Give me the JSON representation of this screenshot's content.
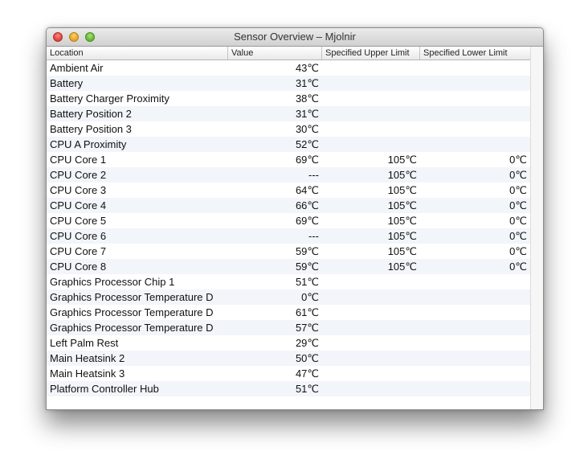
{
  "window": {
    "title": "Sensor Overview – Mjolnir"
  },
  "table": {
    "columns": [
      "Location",
      "Value",
      "Specified Upper Limit",
      "Specified Lower Limit"
    ],
    "rows": [
      {
        "location": "Ambient Air",
        "value": "43℃",
        "upper": "",
        "lower": ""
      },
      {
        "location": "Battery",
        "value": "31℃",
        "upper": "",
        "lower": ""
      },
      {
        "location": "Battery Charger Proximity",
        "value": "38℃",
        "upper": "",
        "lower": ""
      },
      {
        "location": "Battery Position 2",
        "value": "31℃",
        "upper": "",
        "lower": ""
      },
      {
        "location": "Battery Position 3",
        "value": "30℃",
        "upper": "",
        "lower": ""
      },
      {
        "location": "CPU A Proximity",
        "value": "52℃",
        "upper": "",
        "lower": ""
      },
      {
        "location": "CPU Core 1",
        "value": "69℃",
        "upper": "105℃",
        "lower": "0℃"
      },
      {
        "location": "CPU Core 2",
        "value": "---",
        "upper": "105℃",
        "lower": "0℃"
      },
      {
        "location": "CPU Core 3",
        "value": "64℃",
        "upper": "105℃",
        "lower": "0℃"
      },
      {
        "location": "CPU Core 4",
        "value": "66℃",
        "upper": "105℃",
        "lower": "0℃"
      },
      {
        "location": "CPU Core 5",
        "value": "69℃",
        "upper": "105℃",
        "lower": "0℃"
      },
      {
        "location": "CPU Core 6",
        "value": "---",
        "upper": "105℃",
        "lower": "0℃"
      },
      {
        "location": "CPU Core 7",
        "value": "59℃",
        "upper": "105℃",
        "lower": "0℃"
      },
      {
        "location": "CPU Core 8",
        "value": "59℃",
        "upper": "105℃",
        "lower": "0℃"
      },
      {
        "location": "Graphics Processor Chip 1",
        "value": "51℃",
        "upper": "",
        "lower": ""
      },
      {
        "location": "Graphics Processor Temperature D",
        "value": "0℃",
        "upper": "",
        "lower": ""
      },
      {
        "location": "Graphics Processor Temperature D",
        "value": "61℃",
        "upper": "",
        "lower": ""
      },
      {
        "location": "Graphics Processor Temperature D",
        "value": "57℃",
        "upper": "",
        "lower": ""
      },
      {
        "location": "Left Palm Rest",
        "value": "29℃",
        "upper": "",
        "lower": ""
      },
      {
        "location": "Main Heatsink 2",
        "value": "50℃",
        "upper": "",
        "lower": ""
      },
      {
        "location": "Main Heatsink 3",
        "value": "47℃",
        "upper": "",
        "lower": ""
      },
      {
        "location": "Platform Controller Hub",
        "value": "51℃",
        "upper": "",
        "lower": ""
      }
    ]
  }
}
